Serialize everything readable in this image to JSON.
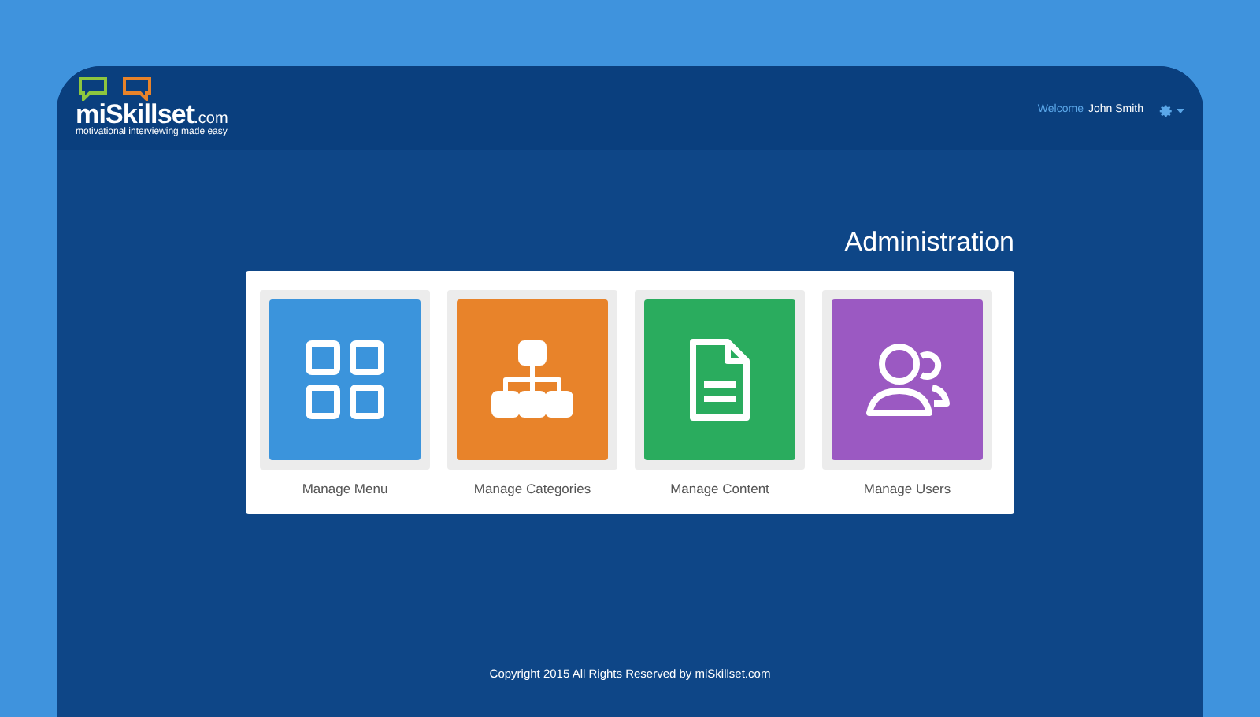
{
  "header": {
    "logo": {
      "name": "miSkillset",
      "domain": ".com",
      "tagline": "motivational interviewing made easy"
    },
    "welcome": "Welcome",
    "user": "John Smith"
  },
  "page_title": "Administration",
  "tiles": [
    {
      "kind": "grid",
      "label": "Manage Menu",
      "color": "#3b94dc"
    },
    {
      "kind": "hierarchy",
      "label": "Manage Categories",
      "color": "#e8832a"
    },
    {
      "kind": "document",
      "label": "Manage Content",
      "color": "#2aac5e"
    },
    {
      "kind": "users",
      "label": "Manage Users",
      "color": "#9b59c2"
    }
  ],
  "footer": "Copyright 2015 All Rights Reserved by miSkillset.com"
}
